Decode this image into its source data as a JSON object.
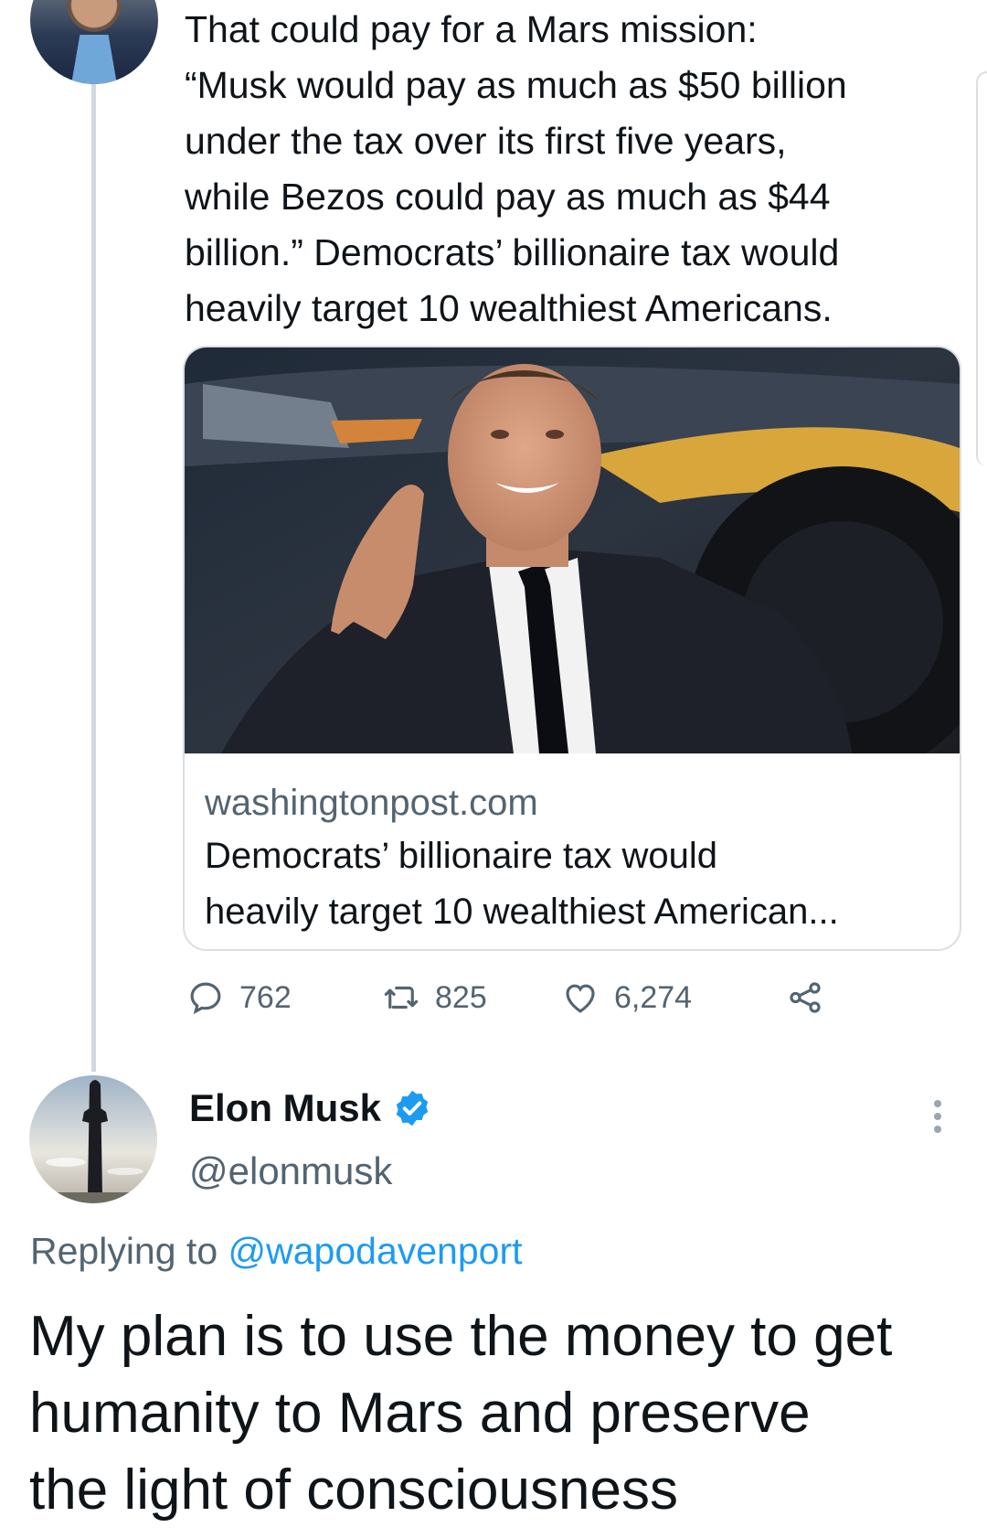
{
  "parent_tweet": {
    "text": "That could pay for a Mars mission:\n“Musk would pay as much as $50 billion\nunder the tax over its first five years,\nwhile Bezos could pay as much as $44\nbillion.” Democrats’ billionaire tax would\nheavily target 10 wealthiest Americans.",
    "link_card": {
      "domain": "washingtonpost.com",
      "title": "Democrats’ billionaire tax would\nheavily target 10 wealthiest American..."
    },
    "actions": {
      "replies": "762",
      "retweets": "825",
      "likes": "6,274"
    }
  },
  "reply_tweet": {
    "author_name": "Elon Musk",
    "handle": "@elonmusk",
    "replying_prefix": "Replying to ",
    "replying_to": "@wapodavenport",
    "text": "My plan is to use the money to get\nhumanity to Mars and preserve\nthe light of consciousness"
  },
  "icons": {
    "reply": "reply-icon",
    "retweet": "retweet-icon",
    "like": "heart-icon",
    "share": "share-icon",
    "verified": "verified-badge-icon",
    "more": "more-options-icon"
  },
  "colors": {
    "text": "#0f1419",
    "secondary": "#536471",
    "accent": "#1d9bf0",
    "border": "#cfd9de"
  }
}
